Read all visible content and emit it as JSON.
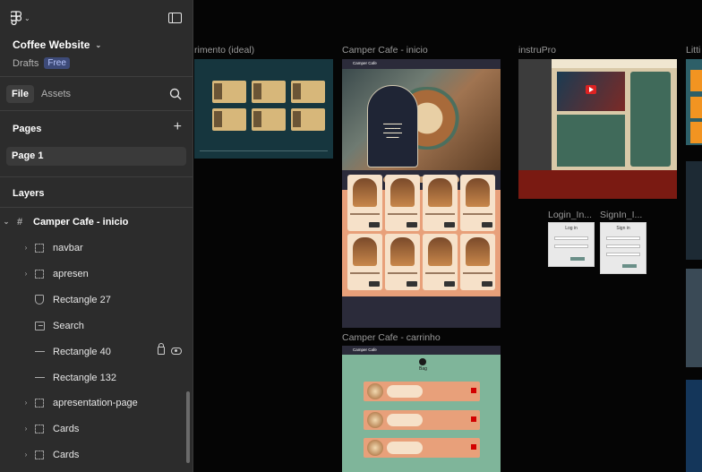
{
  "file": {
    "name": "Coffee Website",
    "location": "Drafts",
    "plan_badge": "Free"
  },
  "tabs": [
    {
      "label": "File",
      "active": true
    },
    {
      "label": "Assets",
      "active": false
    }
  ],
  "pages": {
    "title": "Pages",
    "items": [
      "Page 1"
    ]
  },
  "layers": {
    "title": "Layers",
    "items": [
      {
        "label": "Camper Cafe - inicio",
        "icon": "frame-icon"
      },
      {
        "label": "navbar",
        "icon": "group-icon"
      },
      {
        "label": "apresen",
        "icon": "group-icon"
      },
      {
        "label": "Rectangle 27",
        "icon": "shield-icon"
      },
      {
        "label": "Search",
        "icon": "image-icon"
      },
      {
        "label": "Rectangle 40",
        "icon": "line-icon",
        "locked": true,
        "visible": true
      },
      {
        "label": "Rectangle 132",
        "icon": "line-icon"
      },
      {
        "label": "apresentation-page",
        "icon": "group-icon"
      },
      {
        "label": "Cards",
        "icon": "group-icon"
      },
      {
        "label": "Cards",
        "icon": "group-icon"
      }
    ]
  },
  "canvas": {
    "frames": [
      {
        "label": "rimento (ideal)"
      },
      {
        "label": "Camper Cafe - inicio"
      },
      {
        "label": "instruPro"
      },
      {
        "label": "Litti"
      },
      {
        "label": "Login_In..."
      },
      {
        "label": "SignIn_I..."
      },
      {
        "label": "Camper Cafe - carrinho"
      }
    ],
    "mini_labels": {
      "login": "Log in",
      "signin": "Sign in",
      "nav_brand": "Camper Cafe",
      "cart_title": "Bag"
    }
  },
  "colors": {
    "sidebar_bg": "#2c2c2c",
    "canvas_bg": "#050505",
    "badge_bg": "#3d4a78"
  }
}
